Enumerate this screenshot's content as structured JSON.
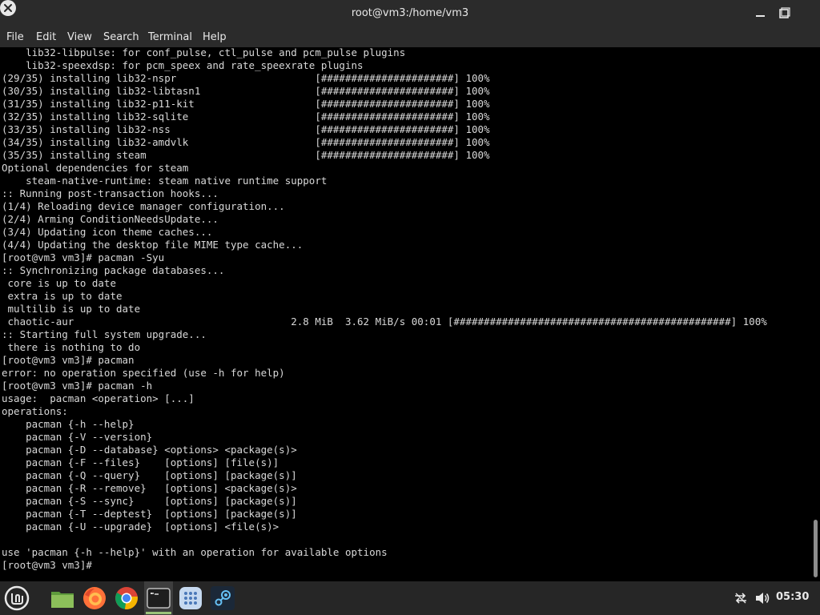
{
  "window": {
    "title": "root@vm3:/home/vm3",
    "minimize_icon": "minimize-icon",
    "maximize_icon": "maximize-icon",
    "close_icon": "close-icon"
  },
  "menubar": {
    "items": [
      "File",
      "Edit",
      "View",
      "Search",
      "Terminal",
      "Help"
    ]
  },
  "terminal": {
    "lines": [
      "    lib32-libpulse: for conf_pulse, ctl_pulse and pcm_pulse plugins",
      "    lib32-speexdsp: for pcm_speex and rate_speexrate plugins",
      "(29/35) installing lib32-nspr                       [######################] 100%",
      "(30/35) installing lib32-libtasn1                   [######################] 100%",
      "(31/35) installing lib32-p11-kit                    [######################] 100%",
      "(32/35) installing lib32-sqlite                     [######################] 100%",
      "(33/35) installing lib32-nss                        [######################] 100%",
      "(34/35) installing lib32-amdvlk                     [######################] 100%",
      "(35/35) installing steam                            [######################] 100%",
      "Optional dependencies for steam",
      "    steam-native-runtime: steam native runtime support",
      ":: Running post-transaction hooks...",
      "(1/4) Reloading device manager configuration...",
      "(2/4) Arming ConditionNeedsUpdate...",
      "(3/4) Updating icon theme caches...",
      "(4/4) Updating the desktop file MIME type cache...",
      "[root@vm3 vm3]# pacman -Syu",
      ":: Synchronizing package databases...",
      " core is up to date",
      " extra is up to date",
      " multilib is up to date",
      " chaotic-aur                                    2.8 MiB  3.62 MiB/s 00:01 [##############################################] 100%",
      ":: Starting full system upgrade...",
      " there is nothing to do",
      "[root@vm3 vm3]# pacman",
      "error: no operation specified (use -h for help)",
      "[root@vm3 vm3]# pacman -h",
      "usage:  pacman <operation> [...]",
      "operations:",
      "    pacman {-h --help}",
      "    pacman {-V --version}",
      "    pacman {-D --database} <options> <package(s)>",
      "    pacman {-F --files}    [options] [file(s)]",
      "    pacman {-Q --query}    [options] [package(s)]",
      "    pacman {-R --remove}   [options] <package(s)>",
      "    pacman {-S --sync}     [options] [package(s)]",
      "    pacman {-T --deptest}  [options] [package(s)]",
      "    pacman {-U --upgrade}  [options] <file(s)>",
      "",
      "use 'pacman {-h --help}' with an operation for available options",
      "[root@vm3 vm3]# "
    ]
  },
  "taskbar": {
    "icons": [
      "mint-menu-icon",
      "files-icon",
      "firefox-icon",
      "chrome-icon",
      "terminal-icon",
      "apps-grid-icon",
      "steam-icon"
    ],
    "tray_icons": [
      "network-icon",
      "volume-icon"
    ],
    "clock": "05:30"
  },
  "colors": {
    "titlebar": "#2b2b2b",
    "terminal_bg": "#000000",
    "terminal_fg": "#d8d8d8",
    "taskbar": "#262626",
    "mint_green": "#8cbf5a"
  }
}
